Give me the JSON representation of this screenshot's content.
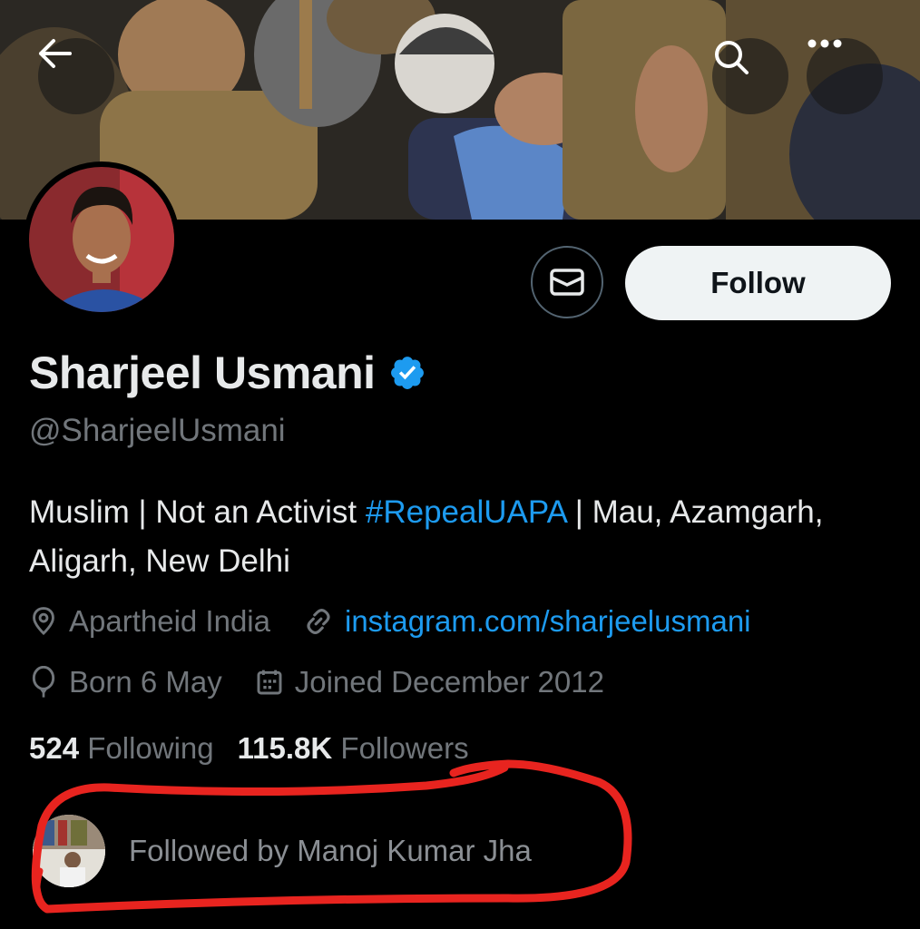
{
  "header": {
    "back_icon": "arrow-left-icon",
    "search_icon": "search-icon",
    "more_icon": "more-dots-icon"
  },
  "profile": {
    "display_name": "Sharjeel Usmani",
    "verified_icon": "verified-badge-icon",
    "handle": "@SharjeelUsmani",
    "bio_part1": "Muslim | Not an Activist ",
    "bio_hashtag": "#RepealUAPA",
    "bio_part2": " | Mau, Azamgarh, Aligarh, New Delhi",
    "location": "Apartheid India",
    "website": "instagram.com/sharjeelusmani",
    "birthday": "Born 6 May",
    "joined": "Joined December 2012"
  },
  "actions": {
    "message_icon": "envelope-icon",
    "follow_label": "Follow"
  },
  "stats": {
    "following_count": "524",
    "following_label": "Following",
    "followers_count": "115.8K",
    "followers_label": "Followers"
  },
  "mutual": {
    "text": "Followed by Manoj Kumar Jha"
  },
  "colors": {
    "accent": "#1d9bf0",
    "text_primary": "#e7e9ea",
    "text_secondary": "#71767b",
    "annotation": "#e8241f"
  }
}
